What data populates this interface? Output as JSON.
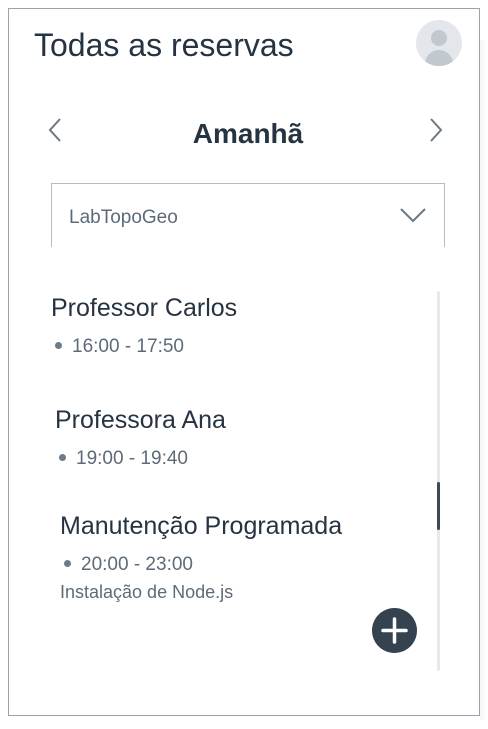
{
  "header": {
    "title": "Todas as reservas",
    "avatar_icon": "user-avatar-icon"
  },
  "date_nav": {
    "label": "Amanhã",
    "prev_icon": "chevron-left-icon",
    "next_icon": "chevron-right-icon"
  },
  "lab_select": {
    "value": "LabTopoGeo",
    "icon": "chevron-down-icon"
  },
  "bookings": [
    {
      "name": "Professor Carlos",
      "time": "16:00 - 17:50",
      "note": ""
    },
    {
      "name": "Professora Ana",
      "time": "19:00 - 19:40",
      "note": ""
    },
    {
      "name": "Manutenção Programada",
      "time": "20:00 - 23:00",
      "note": "Instalação de Node.js"
    }
  ],
  "add_button": {
    "icon": "plus-icon"
  },
  "colors": {
    "text_primary": "#263340",
    "text_secondary": "#5d6b78",
    "accent_dark": "#354250",
    "border": "#9aa3ad"
  }
}
